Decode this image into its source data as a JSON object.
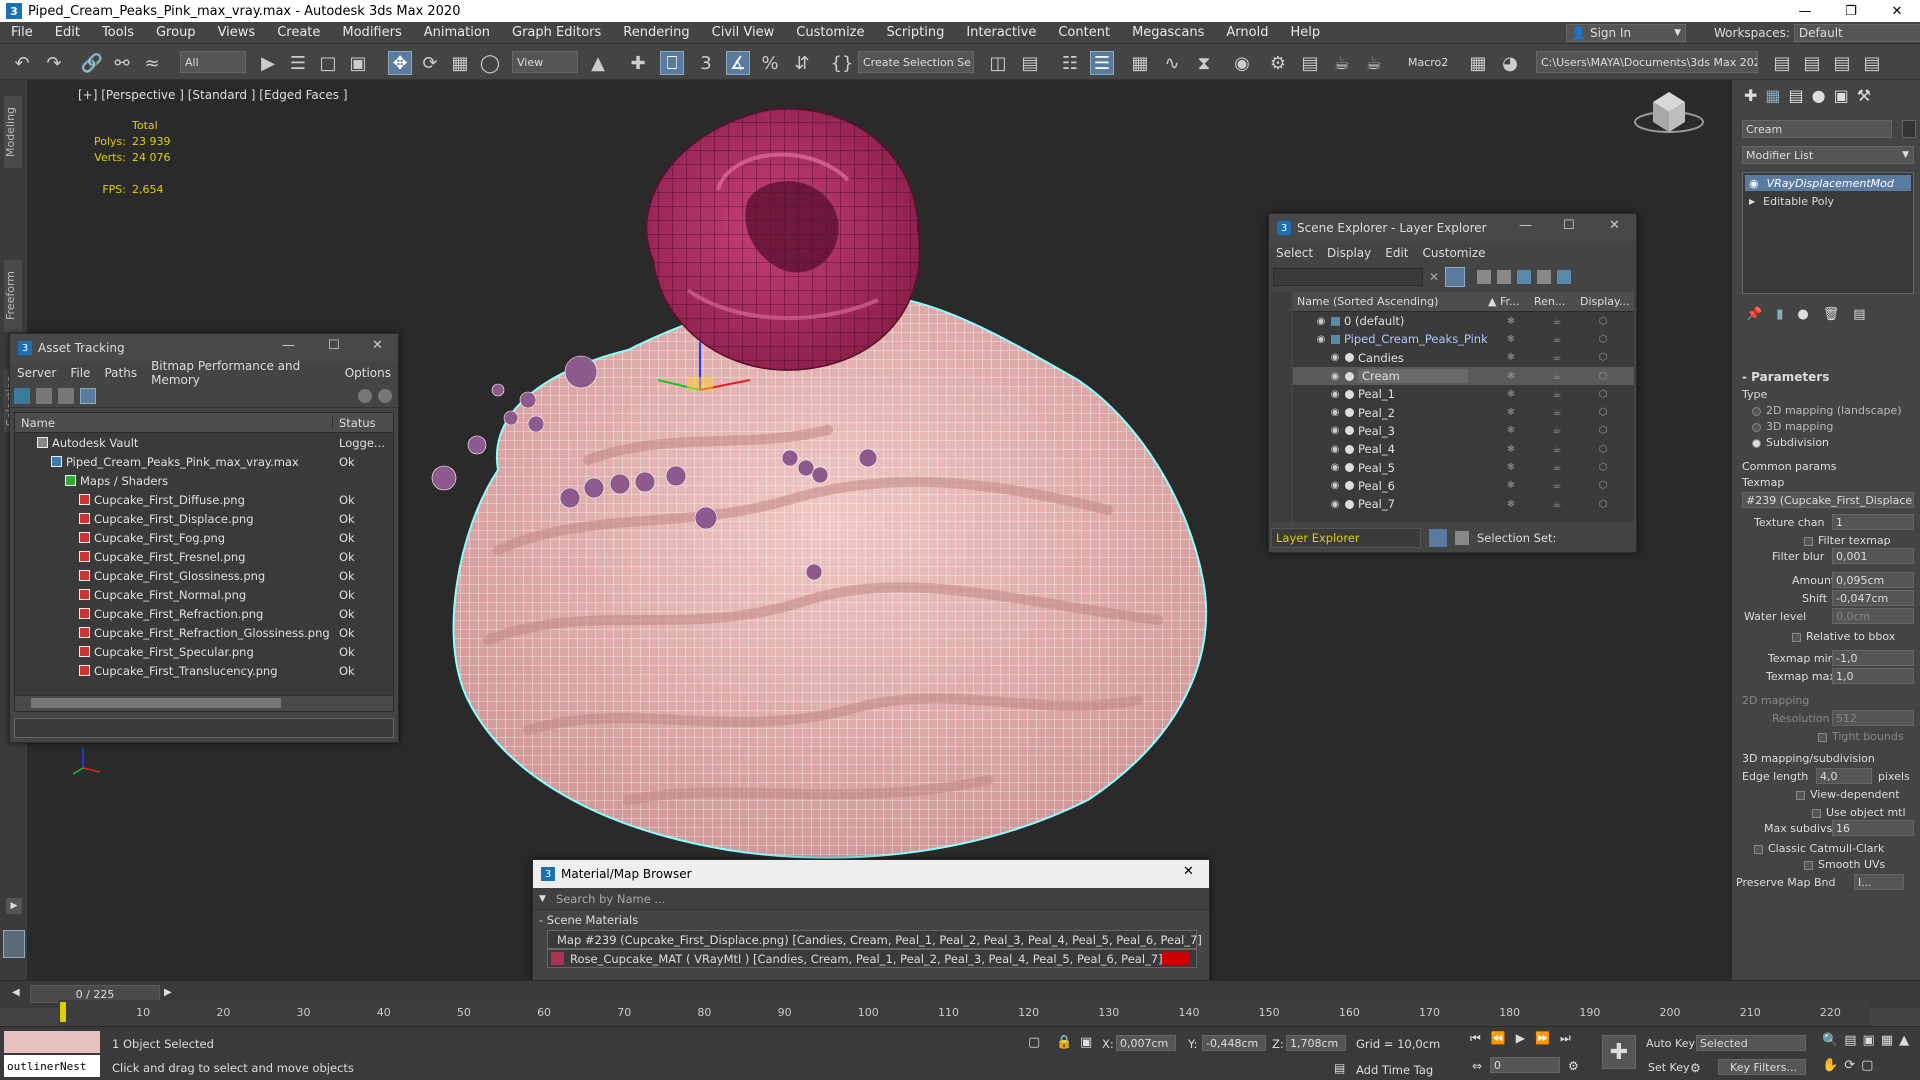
{
  "window": {
    "title": "Piped_Cream_Peaks_Pink_max_vray.max - Autodesk 3ds Max 2020"
  },
  "menu": [
    "File",
    "Edit",
    "Tools",
    "Group",
    "Views",
    "Create",
    "Modifiers",
    "Animation",
    "Graph Editors",
    "Rendering",
    "Civil View",
    "Customize",
    "Scripting",
    "Interactive",
    "Content",
    "Megascans",
    "Arnold",
    "Help"
  ],
  "signin": "Sign In",
  "workspaces": {
    "label": "Workspaces:",
    "value": "Default"
  },
  "toolbar": {
    "filter": "All",
    "view": "View",
    "selection_set": "Create Selection Se",
    "macro": "Macro2",
    "path": "C:\\Users\\MAYA\\Documents\\3ds Max 2020"
  },
  "side_tabs": [
    "Modeling",
    "Freeform",
    "Selection"
  ],
  "viewport": {
    "label": "[+] [Perspective ] [Standard ] [Edged Faces ]",
    "stats": {
      "total": "Total",
      "polys_label": "Polys:",
      "polys": "23 939",
      "verts_label": "Verts:",
      "verts": "24 076",
      "fps_label": "FPS:",
      "fps": "2,654"
    }
  },
  "asset_tracking": {
    "title": "Asset Tracking",
    "menu": [
      "Server",
      "File",
      "Paths",
      "Bitmap Performance and Memory",
      "Options"
    ],
    "columns": [
      "Name",
      "Status"
    ],
    "rows": [
      {
        "name": "Autodesk Vault",
        "status": "Logge...",
        "indent": 1
      },
      {
        "name": "Piped_Cream_Peaks_Pink_max_vray.max",
        "status": "Ok",
        "indent": 2
      },
      {
        "name": "Maps / Shaders",
        "status": "",
        "indent": 3
      },
      {
        "name": "Cupcake_First_Diffuse.png",
        "status": "Ok",
        "indent": 4
      },
      {
        "name": "Cupcake_First_Displace.png",
        "status": "Ok",
        "indent": 4
      },
      {
        "name": "Cupcake_First_Fog.png",
        "status": "Ok",
        "indent": 4
      },
      {
        "name": "Cupcake_First_Fresnel.png",
        "status": "Ok",
        "indent": 4
      },
      {
        "name": "Cupcake_First_Glossiness.png",
        "status": "Ok",
        "indent": 4
      },
      {
        "name": "Cupcake_First_Normal.png",
        "status": "Ok",
        "indent": 4
      },
      {
        "name": "Cupcake_First_Refraction.png",
        "status": "Ok",
        "indent": 4
      },
      {
        "name": "Cupcake_First_Refraction_Glossiness.png",
        "status": "Ok",
        "indent": 4
      },
      {
        "name": "Cupcake_First_Specular.png",
        "status": "Ok",
        "indent": 4
      },
      {
        "name": "Cupcake_First_Translucency.png",
        "status": "Ok",
        "indent": 4
      }
    ]
  },
  "scene_explorer": {
    "title": "Scene Explorer - Layer Explorer",
    "menu": [
      "Select",
      "Display",
      "Edit",
      "Customize"
    ],
    "columns": [
      "Name (Sorted Ascending)",
      "▲ Fr...",
      "Ren...",
      "Display..."
    ],
    "rows": [
      {
        "name": "0 (default)",
        "indent": 1
      },
      {
        "name": "Piped_Cream_Peaks_Pink",
        "indent": 1
      },
      {
        "name": "Candies",
        "indent": 2
      },
      {
        "name": "Cream",
        "indent": 2,
        "selected": true
      },
      {
        "name": "Peal_1",
        "indent": 2
      },
      {
        "name": "Peal_2",
        "indent": 2
      },
      {
        "name": "Peal_3",
        "indent": 2
      },
      {
        "name": "Peal_4",
        "indent": 2
      },
      {
        "name": "Peal_5",
        "indent": 2
      },
      {
        "name": "Peal_6",
        "indent": 2
      },
      {
        "name": "Peal_7",
        "indent": 2
      }
    ],
    "footer_explorer": "Layer Explorer",
    "footer_selset": "Selection Set:"
  },
  "material_browser": {
    "title": "Material/Map Browser",
    "search_placeholder": "Search by Name ...",
    "group": "- Scene Materials",
    "items": [
      "Map #239 (Cupcake_First_Displace.png)  [Candies, Cream, Peal_1, Peal_2, Peal_3, Peal_4, Peal_5, Peal_6, Peal_7]",
      "Rose_Cupcake_MAT  ( VRayMtl )  [Candies, Cream, Peal_1, Peal_2, Peal_3, Peal_4, Peal_5, Peal_6, Peal_7]"
    ]
  },
  "command_panel": {
    "object_name": "Cream",
    "modifier_list": "Modifier List",
    "stack": [
      "VRayDisplacementMod",
      "Editable Poly"
    ],
    "parameters": "Parameters",
    "type_label": "Type",
    "type_options": [
      "2D mapping (landscape)",
      "3D mapping",
      "Subdivision"
    ],
    "common_params": "Common params",
    "texmap_label": "Texmap",
    "texmap_value": "#239 (Cupcake_First_Displace",
    "texture_chan": {
      "label": "Texture chan",
      "value": "1"
    },
    "filter_texmap": "Filter texmap",
    "filter_blur": {
      "label": "Filter blur",
      "value": "0,001"
    },
    "amount": {
      "label": "Amount",
      "value": "0,095cm"
    },
    "shift": {
      "label": "Shift",
      "value": "-0,047cm"
    },
    "water_level": {
      "label": "Water level",
      "value": "0,0cm"
    },
    "relative_bbox": "Relative to bbox",
    "texmap_min": {
      "label": "Texmap min",
      "value": "-1,0"
    },
    "texmap_max": {
      "label": "Texmap max",
      "value": "1,0"
    },
    "mapping2d": "2D mapping",
    "resolution": {
      "label": "Resolution",
      "value": "512"
    },
    "tight_bounds": "Tight bounds",
    "mapping3d": "3D mapping/subdivision",
    "edge_length": {
      "label": "Edge length",
      "value": "4,0",
      "unit": "pixels"
    },
    "view_dependent": "View-dependent",
    "use_object_mtl": "Use object mtl",
    "max_subdivs": {
      "label": "Max subdivs",
      "value": "16"
    },
    "catmull": "Classic Catmull-Clark",
    "smooth_uvs": "Smooth UVs",
    "preserve_map_bnd": {
      "label": "Preserve Map Bnd",
      "value": "I..."
    }
  },
  "timeline": {
    "frame": "0 / 225",
    "ticks": [
      "10",
      "20",
      "30",
      "40",
      "50",
      "60",
      "70",
      "80",
      "90",
      "100",
      "110",
      "120",
      "130",
      "140",
      "150",
      "160",
      "170",
      "180",
      "190",
      "200",
      "210",
      "220"
    ]
  },
  "status": {
    "maxscript": "outlinerNest",
    "selected": "1 Object Selected",
    "hint": "Click and drag to select and move objects",
    "x_label": "X:",
    "x": "0,007cm",
    "y_label": "Y:",
    "y": "-0,448cm",
    "z_label": "Z:",
    "z": "1,708cm",
    "grid": "Grid = 10,0cm",
    "add_time_tag": "Add Time Tag",
    "auto_key": "Auto Key",
    "key_mode": "Selected",
    "set_key": "Set Key",
    "key_filters": "Key Filters...",
    "frame_field": "0"
  }
}
